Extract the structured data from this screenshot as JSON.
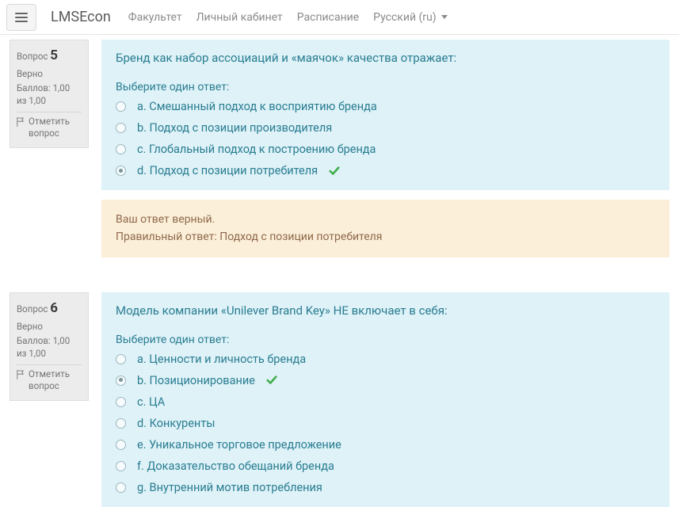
{
  "navbar": {
    "brand": "LMSEcon",
    "links": {
      "faculty": "Факультет",
      "cabinet": "Личный кабинет",
      "schedule": "Расписание",
      "language": "Русский (ru)"
    }
  },
  "questions": [
    {
      "label_prefix": "Вопрос",
      "number": "5",
      "status": "Верно",
      "score": "Баллов: 1,00 из 1,00",
      "flag": "Отметить вопрос",
      "text": "Бренд как набор ассоциаций и «маячок» качества отражает:",
      "prompt": "Выберите один ответ:",
      "answers": [
        {
          "label": "a. Смешанный подход к восприятию бренда",
          "checked": false,
          "correct": false
        },
        {
          "label": "b. Подход с позиции производителя",
          "checked": false,
          "correct": false
        },
        {
          "label": "c. Глобальный подход к построению бренда",
          "checked": false,
          "correct": false
        },
        {
          "label": "d. Подход с позиции потребителя",
          "checked": true,
          "correct": true
        }
      ],
      "feedback": {
        "yours": "Ваш ответ верный.",
        "correct": "Правильный ответ: Подход с позиции потребителя"
      }
    },
    {
      "label_prefix": "Вопрос",
      "number": "6",
      "status": "Верно",
      "score": "Баллов: 1,00 из 1,00",
      "flag": "Отметить вопрос",
      "text": "Модель компании «Unilever Brand Key» НЕ включает в себя:",
      "prompt": "Выберите один ответ:",
      "answers": [
        {
          "label": "a. Ценности и личность бренда",
          "checked": false,
          "correct": false
        },
        {
          "label": "b. Позиционирование",
          "checked": true,
          "correct": true
        },
        {
          "label": "c. ЦА",
          "checked": false,
          "correct": false
        },
        {
          "label": "d. Конкуренты",
          "checked": false,
          "correct": false
        },
        {
          "label": "e. Уникальное торговое предложение",
          "checked": false,
          "correct": false
        },
        {
          "label": "f. Доказательство обещаний бренда",
          "checked": false,
          "correct": false
        },
        {
          "label": "g. Внутренний мотив потребления",
          "checked": false,
          "correct": false
        }
      ],
      "feedback": null
    }
  ]
}
